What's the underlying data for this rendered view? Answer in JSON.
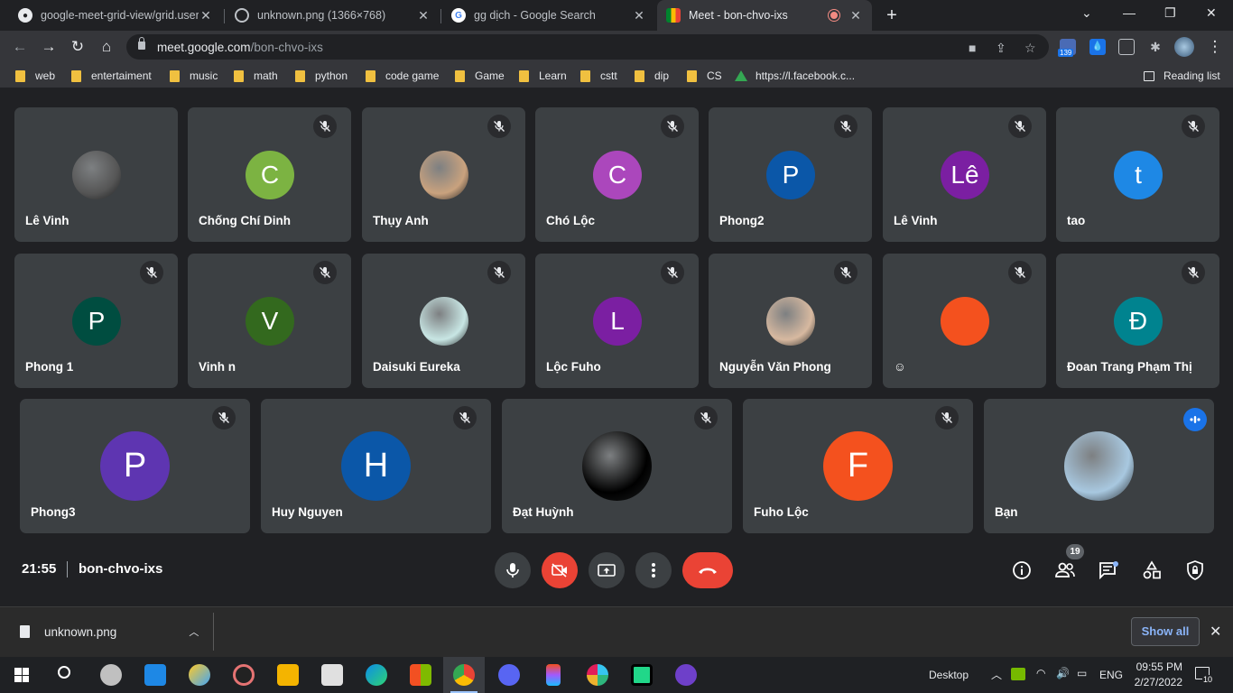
{
  "browser": {
    "tabs": [
      {
        "title": "google-meet-grid-view/grid.user",
        "favicon": "github-icon"
      },
      {
        "title": "unknown.png (1366×768)",
        "favicon": "globe-icon"
      },
      {
        "title": "gg dịch - Google Search",
        "favicon": "google-icon"
      },
      {
        "title": "Meet - bon-chvo-ixs",
        "favicon": "meet-icon",
        "active": true
      }
    ],
    "url_host": "meet.google.com",
    "url_path": "/bon-chvo-ixs",
    "extension_badge": "139",
    "bookmarks": [
      "web",
      "entertaiment",
      "music",
      "math",
      "python",
      "code game",
      "Game",
      "Learn",
      "cstt",
      "dip",
      "CS",
      "https://l.facebook.c..."
    ],
    "reading_list": "Reading list"
  },
  "meet": {
    "participants": [
      {
        "name": "Lê Vinh",
        "initial": "",
        "color": "#555555",
        "muted": false,
        "photo": true
      },
      {
        "name": "Chống Chí Dinh",
        "initial": "C",
        "color": "#7cb342",
        "muted": true
      },
      {
        "name": "Thụy Anh",
        "initial": "",
        "color": "#c9a27e",
        "muted": true,
        "photo": true
      },
      {
        "name": "Chó Lộc",
        "initial": "C",
        "color": "#ab47bc",
        "muted": true
      },
      {
        "name": "Phong2",
        "initial": "P",
        "color": "#0b57a8",
        "muted": true
      },
      {
        "name": "Lê Vinh",
        "initial": "Lê",
        "color": "#7b1fa2",
        "muted": true
      },
      {
        "name": "tao",
        "initial": "t",
        "color": "#1e88e5",
        "muted": true
      },
      {
        "name": "Phong 1",
        "initial": "P",
        "color": "#004d40",
        "muted": true
      },
      {
        "name": "Vinh n",
        "initial": "V",
        "color": "#33691e",
        "muted": true
      },
      {
        "name": "Daisuki Eureka",
        "initial": "",
        "color": "#c8e6e4",
        "muted": true,
        "photo": true
      },
      {
        "name": "Lộc Fuho",
        "initial": "L",
        "color": "#7b1fa2",
        "muted": true
      },
      {
        "name": "Nguyễn Văn Phong",
        "initial": "",
        "color": "#d7b9a0",
        "muted": true,
        "photo": true
      },
      {
        "name": "☺",
        "initial": "",
        "color": "#f4511e",
        "muted": true
      },
      {
        "name": "Đoan Trang Phạm Thị",
        "initial": "Đ",
        "color": "#00838f",
        "muted": true
      },
      {
        "name": "Phong3",
        "initial": "P",
        "color": "#5e35b1",
        "muted": true
      },
      {
        "name": "Huy Nguyen",
        "initial": "H",
        "color": "#0b57a8",
        "muted": true
      },
      {
        "name": "Đạt Huỳnh",
        "initial": "",
        "color": "#000000",
        "muted": true,
        "photo": true
      },
      {
        "name": "Fuho Lộc",
        "initial": "F",
        "color": "#f4511e",
        "muted": true
      },
      {
        "name": "Bạn",
        "initial": "",
        "color": "#a8c8e0",
        "muted": false,
        "speaking": true,
        "photo": true
      }
    ],
    "time": "21:55",
    "meeting_code": "bon-chvo-ixs",
    "people_count": "19"
  },
  "download": {
    "file": "unknown.png",
    "show_all": "Show all"
  },
  "taskbar": {
    "desktop_label": "Desktop",
    "language": "ENG",
    "time": "09:55 PM",
    "date": "2/27/2022",
    "notifications": "10"
  }
}
